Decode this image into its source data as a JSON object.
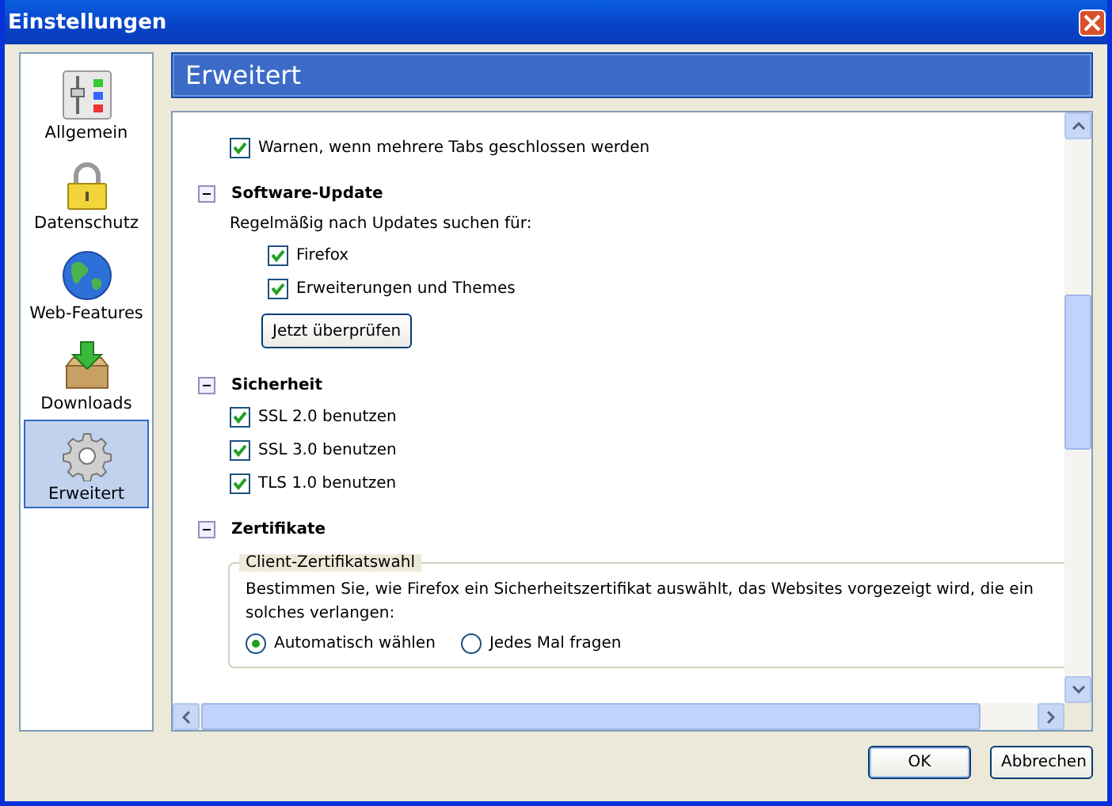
{
  "window": {
    "title": "Einstellungen"
  },
  "sidebar": {
    "items": [
      {
        "label": "Allgemein",
        "selected": false,
        "kind": "sliders"
      },
      {
        "label": "Datenschutz",
        "selected": false,
        "kind": "lock"
      },
      {
        "label": "Web-Features",
        "selected": false,
        "kind": "globe"
      },
      {
        "label": "Downloads",
        "selected": false,
        "kind": "box"
      },
      {
        "label": "Erweitert",
        "selected": true,
        "kind": "gear"
      }
    ]
  },
  "header": "Erweitert",
  "content": [
    {
      "kind": "checkbox",
      "label": "Warnen, wenn mehrere Tabs geschlossen werden",
      "checked": true
    },
    {
      "kind": "section",
      "title": "Software-Update",
      "expanded": true,
      "items": [
        {
          "kind": "text",
          "label": "Regelmäßig nach Updates suchen für:"
        },
        {
          "kind": "subcheckbox",
          "label": "Firefox",
          "checked": true
        },
        {
          "kind": "subcheckbox",
          "label": "Erweiterungen und Themes",
          "checked": true
        },
        {
          "kind": "button",
          "label": "Jetzt überprüfen"
        }
      ]
    },
    {
      "kind": "section",
      "title": "Sicherheit",
      "expanded": true,
      "items": [
        {
          "kind": "checkbox",
          "label": "SSL 2.0 benutzen",
          "checked": true
        },
        {
          "kind": "checkbox",
          "label": "SSL 3.0 benutzen",
          "checked": true
        },
        {
          "kind": "checkbox",
          "label": "TLS 1.0 benutzen",
          "checked": true
        }
      ]
    },
    {
      "kind": "section",
      "title": "Zertifikate",
      "expanded": true,
      "items": [
        {
          "kind": "group",
          "legend": "Client-Zertifikatswahl",
          "text": "Bestimmen Sie, wie Firefox ein Sicherheitszertifikat auswählt, das Websites vorgezeigt wird, die ein solches verlangen:",
          "options": [
            {
              "label": "Automatisch wählen",
              "selected": true
            },
            {
              "label": "Jedes Mal fragen",
              "selected": false
            }
          ]
        }
      ]
    }
  ],
  "buttons": [
    {
      "label": "OK",
      "default": true
    },
    {
      "label": "Abbrechen",
      "default": false
    }
  ]
}
